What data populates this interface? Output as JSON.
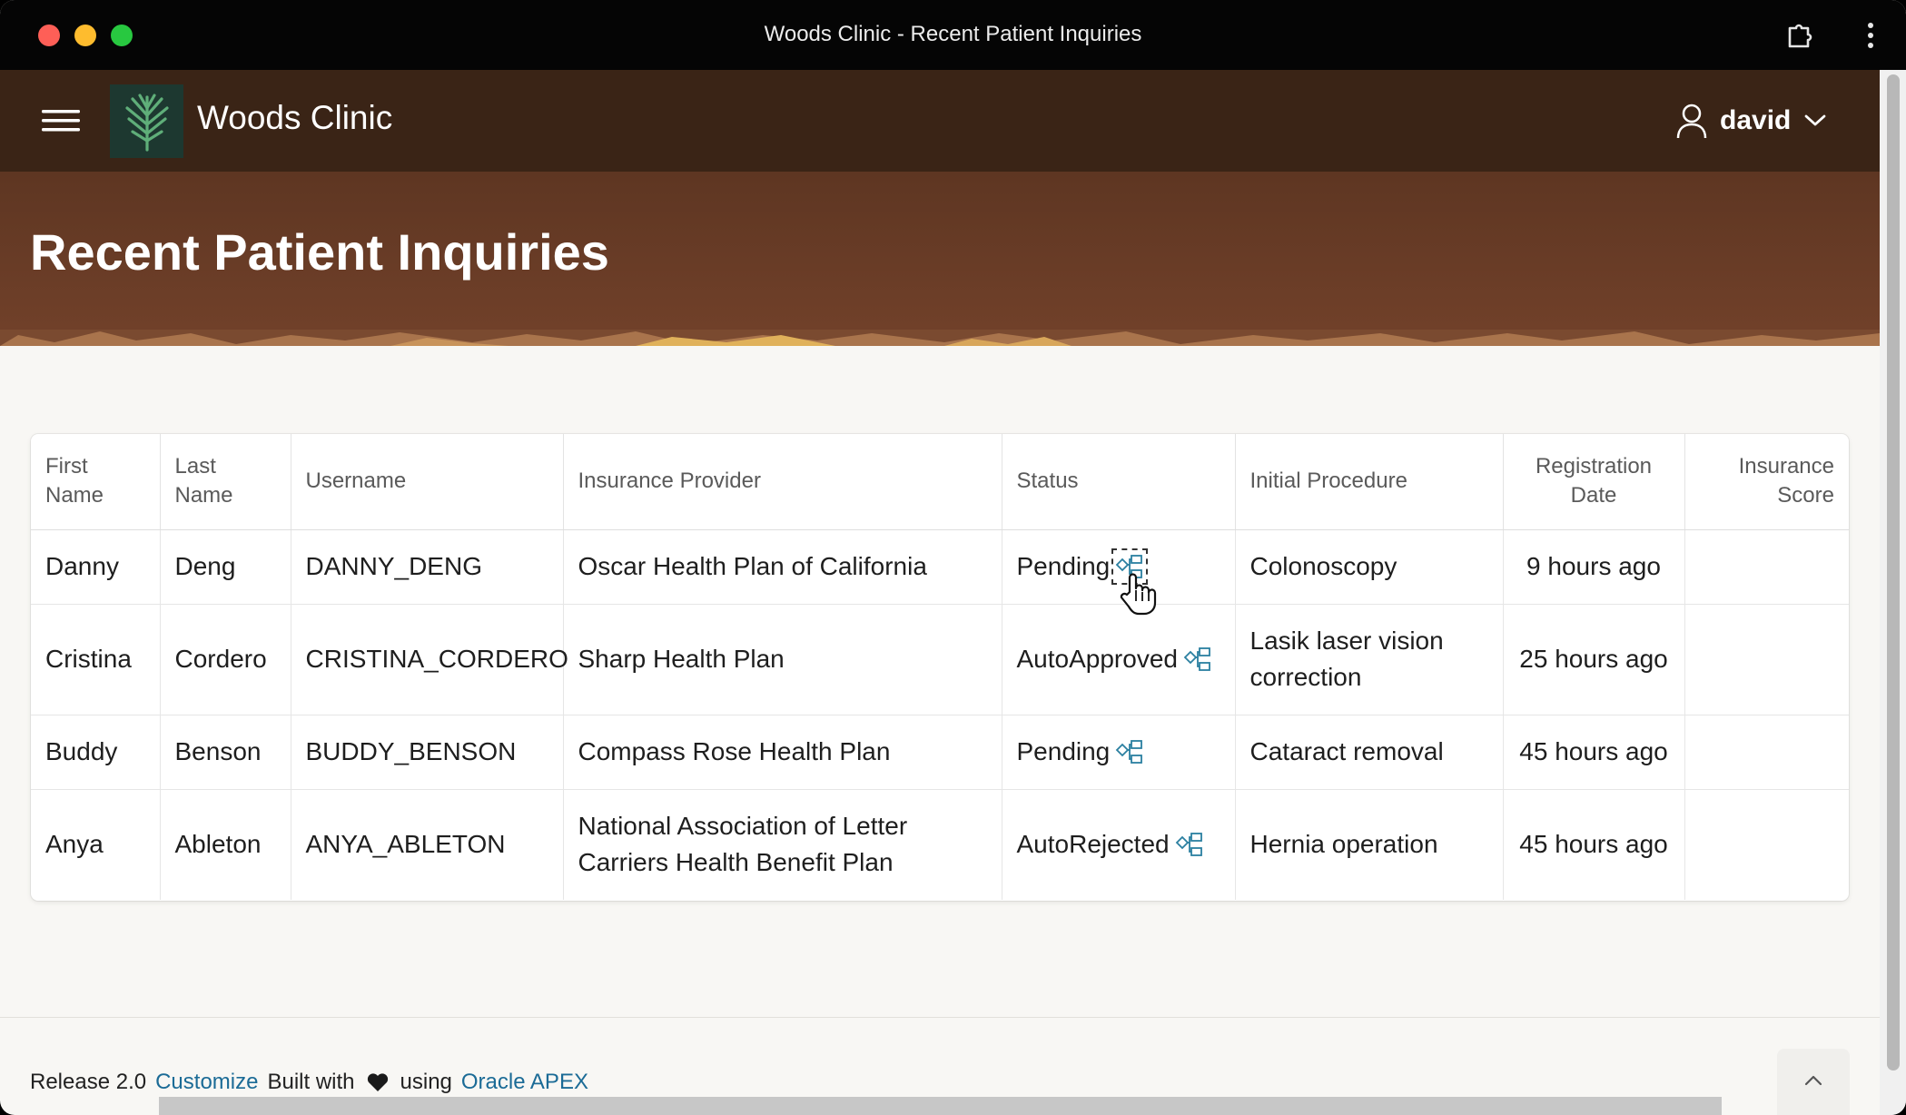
{
  "window": {
    "title": "Woods Clinic - Recent Patient Inquiries"
  },
  "header": {
    "brand": "Woods Clinic",
    "user": "david"
  },
  "hero": {
    "title": "Recent Patient Inquiries"
  },
  "table": {
    "columns": {
      "first_name": "First Name",
      "last_name": "Last Name",
      "username": "Username",
      "insurance_provider": "Insurance Provider",
      "status": "Status",
      "initial_procedure": "Initial Procedure",
      "registration_date": "Registration Date",
      "insurance_score": "Insurance Score"
    },
    "rows": [
      {
        "first_name": "Danny",
        "last_name": "Deng",
        "username": "DANNY_DENG",
        "insurance_provider": "Oscar Health Plan of California",
        "status": "Pending",
        "initial_procedure": "Colonoscopy",
        "registration_date": "9 hours ago",
        "insurance_score": ""
      },
      {
        "first_name": "Cristina",
        "last_name": "Cordero",
        "username": "CRISTINA_CORDERO",
        "insurance_provider": "Sharp Health Plan",
        "status": "AutoApproved",
        "initial_procedure": "Lasik laser vision correction",
        "registration_date": "25 hours ago",
        "insurance_score": ""
      },
      {
        "first_name": "Buddy",
        "last_name": "Benson",
        "username": "BUDDY_BENSON",
        "insurance_provider": "Compass Rose Health Plan",
        "status": "Pending",
        "initial_procedure": "Cataract removal",
        "registration_date": "45 hours ago",
        "insurance_score": ""
      },
      {
        "first_name": "Anya",
        "last_name": "Ableton",
        "username": "ANYA_ABLETON",
        "insurance_provider": "National Association of Letter Carriers Health Benefit Plan",
        "status": "AutoRejected",
        "initial_procedure": "Hernia operation",
        "registration_date": "45 hours ago",
        "insurance_score": ""
      }
    ]
  },
  "footer": {
    "release": "Release 2.0",
    "customize": "Customize",
    "built_with": "Built with",
    "using": "using",
    "apex": "Oracle APEX"
  },
  "colors": {
    "header_bg": "#3a2416",
    "hero_bg": "#72412a",
    "link": "#1b6b96",
    "flow_icon": "#2a7fa0"
  },
  "icons": [
    "menu-icon",
    "tree-logo-icon",
    "user-icon",
    "chevron-down-icon",
    "workflow-icon",
    "heart-icon",
    "chevron-up-icon",
    "extension-icon",
    "kebab-icon"
  ]
}
